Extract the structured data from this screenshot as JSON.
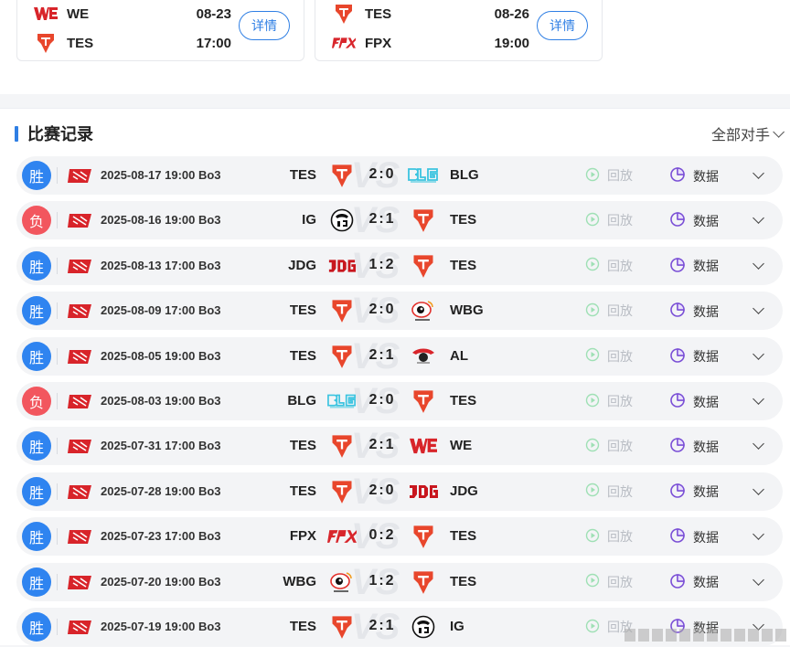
{
  "upcoming": [
    {
      "team1": "WE",
      "team2": "TES",
      "date": "08-23",
      "time": "17:00",
      "button": "详情"
    },
    {
      "team1": "TES",
      "team2": "FPX",
      "date": "08-26",
      "time": "19:00",
      "button": "详情"
    }
  ],
  "records": {
    "title": "比赛记录",
    "filter": "全部对手",
    "replay_label": "回放",
    "data_label": "数据",
    "matches": [
      {
        "result": "胜",
        "win": true,
        "datetime": "2025-08-17 19:00 Bo3",
        "team1": "TES",
        "score": "2:0",
        "team2": "BLG"
      },
      {
        "result": "负",
        "win": false,
        "datetime": "2025-08-16 19:00 Bo3",
        "team1": "IG",
        "score": "2:1",
        "team2": "TES"
      },
      {
        "result": "胜",
        "win": true,
        "datetime": "2025-08-13 17:00 Bo3",
        "team1": "JDG",
        "score": "1:2",
        "team2": "TES"
      },
      {
        "result": "胜",
        "win": true,
        "datetime": "2025-08-09 17:00 Bo3",
        "team1": "TES",
        "score": "2:0",
        "team2": "WBG"
      },
      {
        "result": "胜",
        "win": true,
        "datetime": "2025-08-05 19:00 Bo3",
        "team1": "TES",
        "score": "2:1",
        "team2": "AL"
      },
      {
        "result": "负",
        "win": false,
        "datetime": "2025-08-03 19:00 Bo3",
        "team1": "BLG",
        "score": "2:0",
        "team2": "TES"
      },
      {
        "result": "胜",
        "win": true,
        "datetime": "2025-07-31 17:00 Bo3",
        "team1": "TES",
        "score": "2:1",
        "team2": "WE"
      },
      {
        "result": "胜",
        "win": true,
        "datetime": "2025-07-28 19:00 Bo3",
        "team1": "TES",
        "score": "2:0",
        "team2": "JDG"
      },
      {
        "result": "胜",
        "win": true,
        "datetime": "2025-07-23 17:00 Bo3",
        "team1": "FPX",
        "score": "0:2",
        "team2": "TES"
      },
      {
        "result": "胜",
        "win": true,
        "datetime": "2025-07-20 19:00 Bo3",
        "team1": "WBG",
        "score": "1:2",
        "team2": "TES"
      },
      {
        "result": "胜",
        "win": true,
        "datetime": "2025-07-19 19:00 Bo3",
        "team1": "TES",
        "score": "2:1",
        "team2": "IG"
      }
    ]
  },
  "colors": {
    "accent": "#2f7fe4",
    "win": "#2f84f0",
    "loss": "#f2565e",
    "tes": "#e8462c",
    "we": "#d8242a",
    "blg": "#3cc4e0",
    "fpx": "#d8262c",
    "jdg": "#c8161e"
  },
  "watermark_text": ""
}
